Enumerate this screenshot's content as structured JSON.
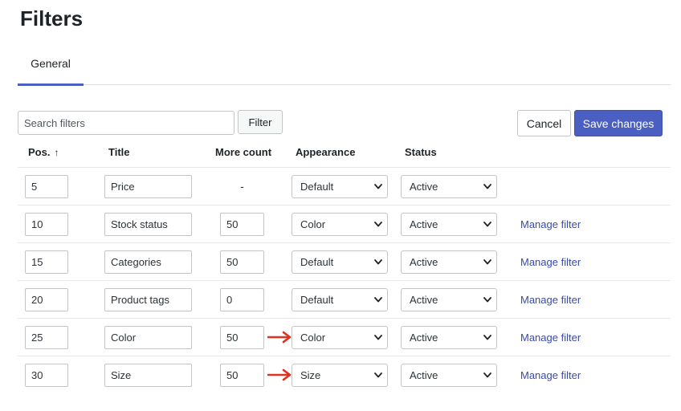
{
  "page": {
    "title": "Filters"
  },
  "tabs": [
    {
      "label": "General",
      "active": true
    }
  ],
  "toolbar": {
    "search_placeholder": "Search filters",
    "search_value": "",
    "filter_button": "Filter",
    "cancel_button": "Cancel",
    "save_button": "Save changes"
  },
  "table": {
    "headers": {
      "pos": "Pos.",
      "title": "Title",
      "more_count": "More count",
      "appearance": "Appearance",
      "status": "Status"
    },
    "sort_icon": "arrow-up-icon",
    "rows": [
      {
        "pos": "5",
        "title": "Price",
        "more_count": "-",
        "appearance": "Default",
        "status": "Active",
        "manage": "",
        "highlighted": false
      },
      {
        "pos": "10",
        "title": "Stock status",
        "more_count": "50",
        "appearance": "Color",
        "status": "Active",
        "manage": "Manage filter",
        "highlighted": false
      },
      {
        "pos": "15",
        "title": "Categories",
        "more_count": "50",
        "appearance": "Default",
        "status": "Active",
        "manage": "Manage filter",
        "highlighted": false
      },
      {
        "pos": "20",
        "title": "Product tags",
        "more_count": "0",
        "appearance": "Default",
        "status": "Active",
        "manage": "Manage filter",
        "highlighted": false
      },
      {
        "pos": "25",
        "title": "Color",
        "more_count": "50",
        "appearance": "Color",
        "status": "Active",
        "manage": "Manage filter",
        "highlighted": true
      },
      {
        "pos": "30",
        "title": "Size",
        "more_count": "50",
        "appearance": "Size",
        "status": "Active",
        "manage": "Manage filter",
        "highlighted": true
      }
    ]
  },
  "colors": {
    "accent": "#4a5fc1",
    "link": "#3a4aa8",
    "annotation_arrow": "#e0301e"
  }
}
